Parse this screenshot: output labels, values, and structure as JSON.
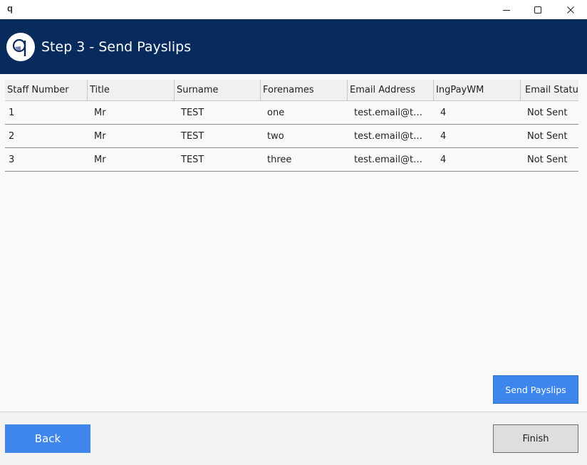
{
  "window": {
    "icon": "q",
    "minimize_icon": "minimize-icon",
    "maximize_icon": "maximize-icon",
    "close_icon": "close-icon"
  },
  "header": {
    "logo_icon": "q-logo-icon",
    "title": "Step 3 - Send Payslips",
    "background": "#082b5e"
  },
  "table": {
    "columns": [
      "Staff Number",
      "Title",
      "Surname",
      "Forenames",
      "Email Address",
      "IngPayWM",
      "Email Status"
    ],
    "rows": [
      [
        "1",
        "Mr",
        "TEST",
        "one",
        "test.email@tes...",
        "4",
        "Not Sent"
      ],
      [
        "2",
        "Mr",
        "TEST",
        "two",
        "test.email@tes...",
        "4",
        "Not Sent"
      ],
      [
        "3",
        "Mr",
        "TEST",
        "three",
        "test.email@tes...",
        "4",
        "Not Sent"
      ]
    ]
  },
  "buttons": {
    "send_payslips": "Send Payslips",
    "back": "Back",
    "finish": "Finish"
  },
  "colors": {
    "accent": "#3e86ec",
    "header": "#082b5e"
  }
}
